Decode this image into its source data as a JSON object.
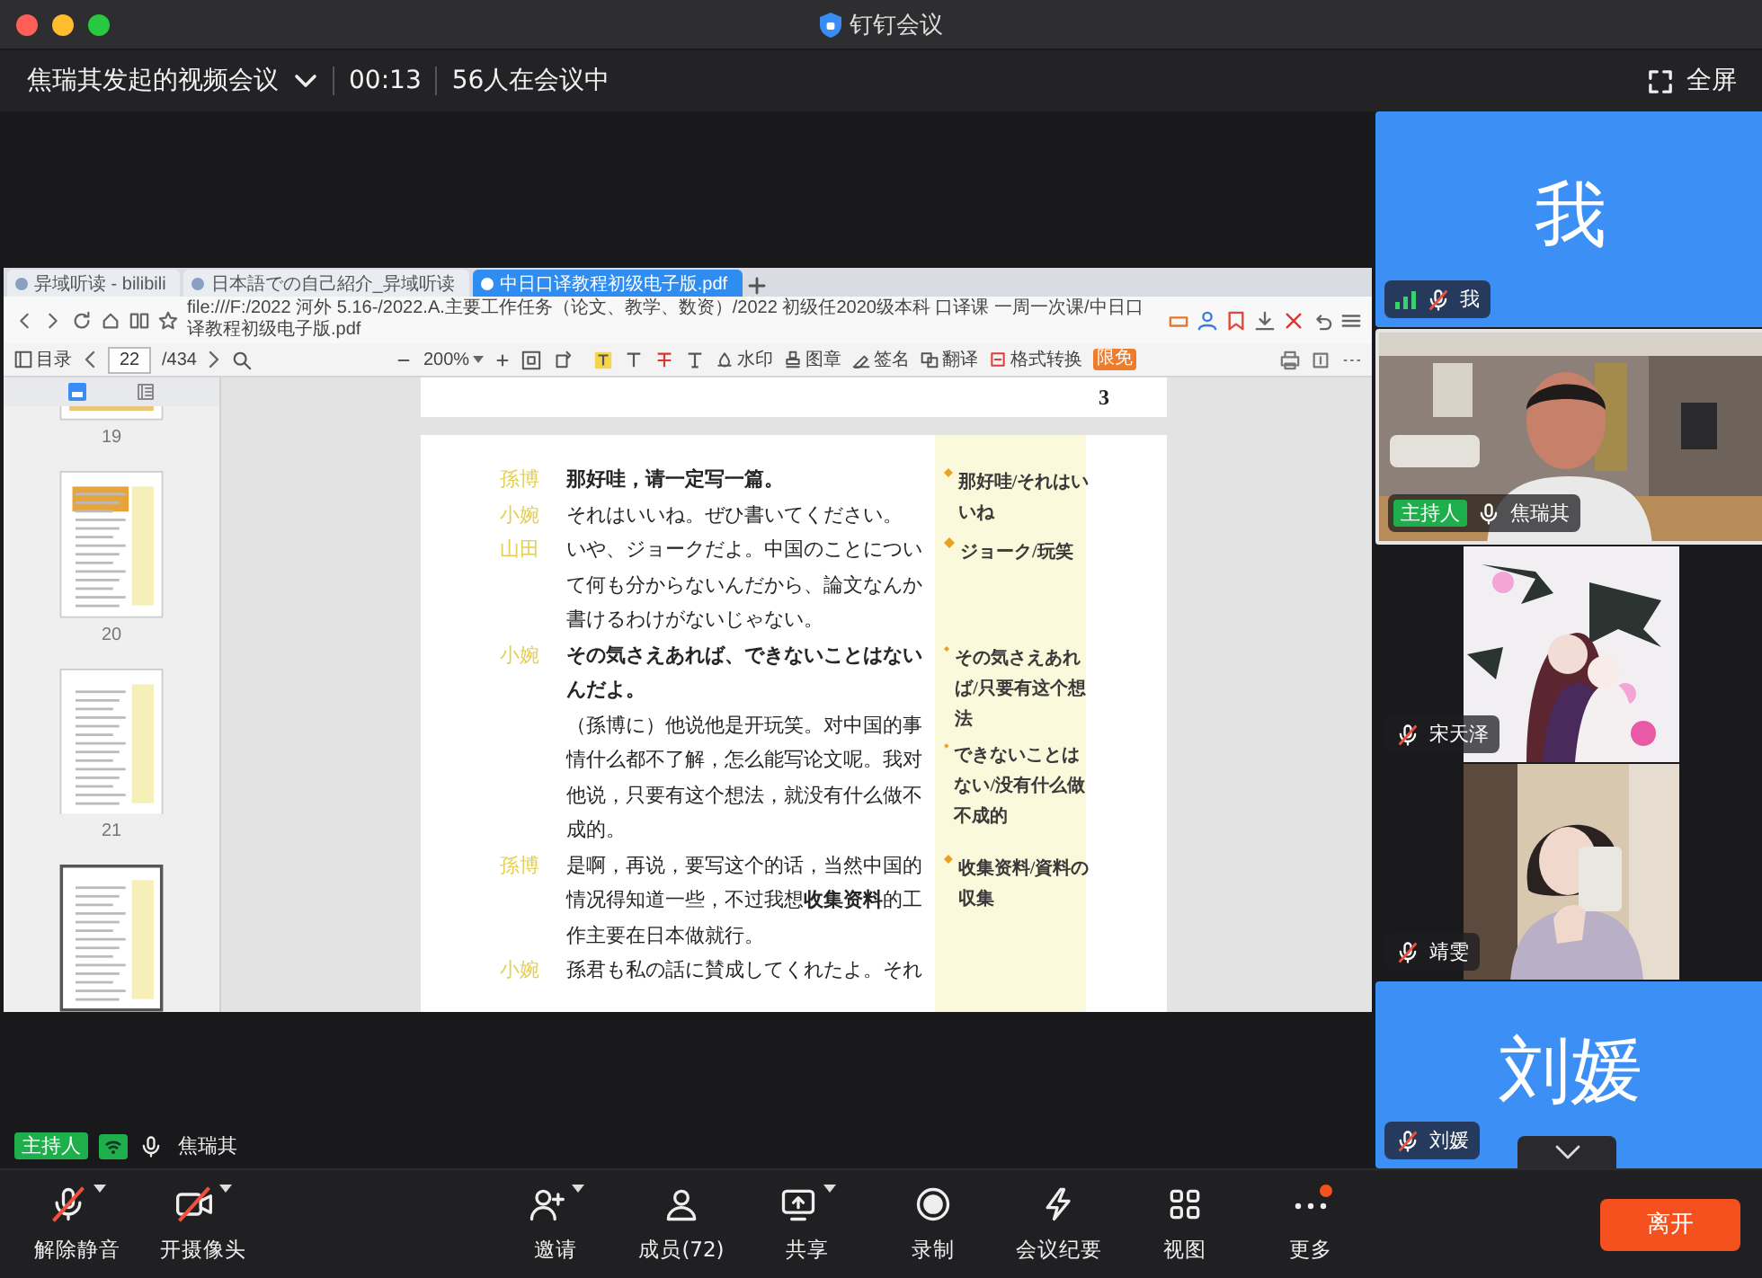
{
  "window": {
    "title": "钉钉会议"
  },
  "meeting": {
    "title": "焦瑞其发起的视频会议",
    "elapsed": "00:13",
    "attendance": "56人在会议中",
    "fullscreen_label": "全屏"
  },
  "shared_screen": {
    "tabs": [
      {
        "label": "异域听读 - bilibili",
        "selected": false
      },
      {
        "label": "日本語での自己紹介_异域听读",
        "selected": false
      },
      {
        "label": "中日口译教程初级电子版.pdf",
        "selected": true
      }
    ],
    "address": "file:///F:/2022 河外 5.16-/2022.A.主要工作任务（论文、教学、数资）/2022 初级任2020级本科 口译课 一周一次课/中日口译教程初级电子版.pdf",
    "pdf_toolbar": {
      "outline": "目录",
      "page": "22",
      "page_count": "/434",
      "zoom": "200%",
      "tools": [
        {
          "kind": "watermark",
          "label": "水印"
        },
        {
          "kind": "stamp",
          "label": "图章"
        },
        {
          "kind": "sign",
          "label": "签名"
        },
        {
          "kind": "translate",
          "label": "翻译"
        },
        {
          "kind": "convert",
          "label": "格式转换"
        }
      ],
      "badge": "限免"
    },
    "thumbnails": [
      {
        "label": "19",
        "selected": false
      },
      {
        "label": "20",
        "selected": false
      },
      {
        "label": "21",
        "selected": false
      },
      {
        "selected": true
      }
    ],
    "previous_page_number": "3",
    "dialogue": [
      {
        "speaker": "孫博",
        "lines": [
          {
            "text": "那好哇，请一定写一篇。",
            "bold": true
          }
        ],
        "notes": [
          "那好哇/それはいいね"
        ]
      },
      {
        "speaker": "小婉",
        "lines": [
          {
            "text": "それはいいね。ぜひ書いてください。",
            "bold": false
          }
        ]
      },
      {
        "speaker": "山田",
        "lines": [
          {
            "text": "いや、ジョークだよ。中国のことについて何も分からないんだから、論文なんか書けるわけがないじゃない。",
            "bold": false
          }
        ],
        "notes": [
          "ジョーク/玩笑"
        ]
      },
      {
        "speaker": "小婉",
        "lines": [
          {
            "text": "その気さえあれば、できないことはないんだよ。",
            "bold": true
          },
          {
            "text": "（孫博に）他说他是开玩笑。对中国的事情什么都不了解，怎么能写论文呢。我对他说，只要有这个想法，就没有什么做不成的。",
            "bold": false
          }
        ],
        "notes": [
          "その気さえあれば/只要有这个想法",
          "できないことはない/没有什么做不成的"
        ]
      },
      {
        "speaker": "孫博",
        "lines": [
          {
            "text": "是啊，再说，要写这个的话，当然中国的情况得知道一些，不过我想**收集资料**的工作主要在日本做就行。",
            "bold": false
          }
        ],
        "notes": [
          "收集资料/資料の収集"
        ]
      },
      {
        "speaker": "小婉",
        "lines": [
          {
            "text": "孫君も私の話に賛成してくれたよ。それ",
            "bold": false
          }
        ]
      }
    ]
  },
  "presenter": {
    "role": "主持人",
    "name": "焦瑞其",
    "muted": false
  },
  "participants": [
    {
      "kind": "avatar",
      "avatar_text": "我",
      "name": "我",
      "muted": true,
      "network_indicator": true,
      "speaking": false
    },
    {
      "kind": "video",
      "role": "主持人",
      "name": "焦瑞其",
      "muted": false,
      "network_indicator": false,
      "speaking": true
    },
    {
      "kind": "video",
      "name": "宋天泽",
      "muted": true,
      "network_indicator": false,
      "speaking": false
    },
    {
      "kind": "video",
      "name": "靖雯",
      "muted": true,
      "network_indicator": false,
      "speaking": false
    },
    {
      "kind": "avatar",
      "avatar_text": "刘媛",
      "name": "刘媛",
      "muted": true,
      "network_indicator": false,
      "speaking": false
    }
  ],
  "toolbar": [
    {
      "kind": "mic",
      "label": "解除静音",
      "menu": true,
      "off": true,
      "notification": false
    },
    {
      "kind": "camera",
      "label": "开摄像头",
      "menu": true,
      "off": true,
      "notification": false
    },
    {
      "kind": "invite",
      "label": "邀请",
      "menu": true,
      "off": false,
      "notification": false
    },
    {
      "kind": "members",
      "label": "成员(72)",
      "menu": false,
      "off": false,
      "notification": false
    },
    {
      "kind": "share",
      "label": "共享",
      "menu": true,
      "off": false,
      "notification": false
    },
    {
      "kind": "record",
      "label": "录制",
      "menu": false,
      "off": false,
      "notification": false
    },
    {
      "kind": "minutes",
      "label": "会议纪要",
      "menu": false,
      "off": false,
      "notification": false
    },
    {
      "kind": "view",
      "label": "视图",
      "menu": false,
      "off": false,
      "notification": false
    },
    {
      "kind": "more",
      "label": "更多",
      "menu": false,
      "off": false,
      "notification": true
    }
  ],
  "leave_button": "离开"
}
